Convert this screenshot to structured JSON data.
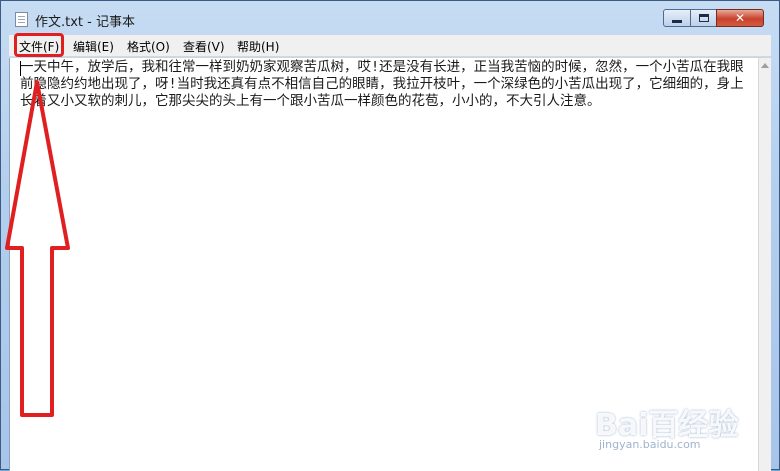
{
  "window": {
    "title": "作文.txt - 记事本",
    "controls": {
      "minimize_icon": "minimize-icon",
      "maximize_icon": "maximize-icon",
      "close_label": "✕"
    }
  },
  "menubar": {
    "items": [
      {
        "label": "文件(F)"
      },
      {
        "label": "编辑(E)"
      },
      {
        "label": "格式(O)"
      },
      {
        "label": "查看(V)"
      },
      {
        "label": "帮助(H)"
      }
    ]
  },
  "editor": {
    "content": "一天中午，放学后，我和往常一样到奶奶家观察苦瓜树，哎!还是没有长进，正当我苦恼的时候，忽然，一个小苦瓜在我眼前隐隐约约地出现了，呀!当时我还真有点不相信自己的眼睛，我拉开枝叶，一个深绿色的小苦瓜出现了，它细细的，身上长着又小又软的刺儿，它那尖尖的头上有一个跟小苦瓜一样颜色的花苞，小小的，不大引人注意。"
  },
  "annotation": {
    "color": "#e02020"
  },
  "watermark": {
    "main": "Bai百经验",
    "sub": "jingyan.baidu.com"
  }
}
